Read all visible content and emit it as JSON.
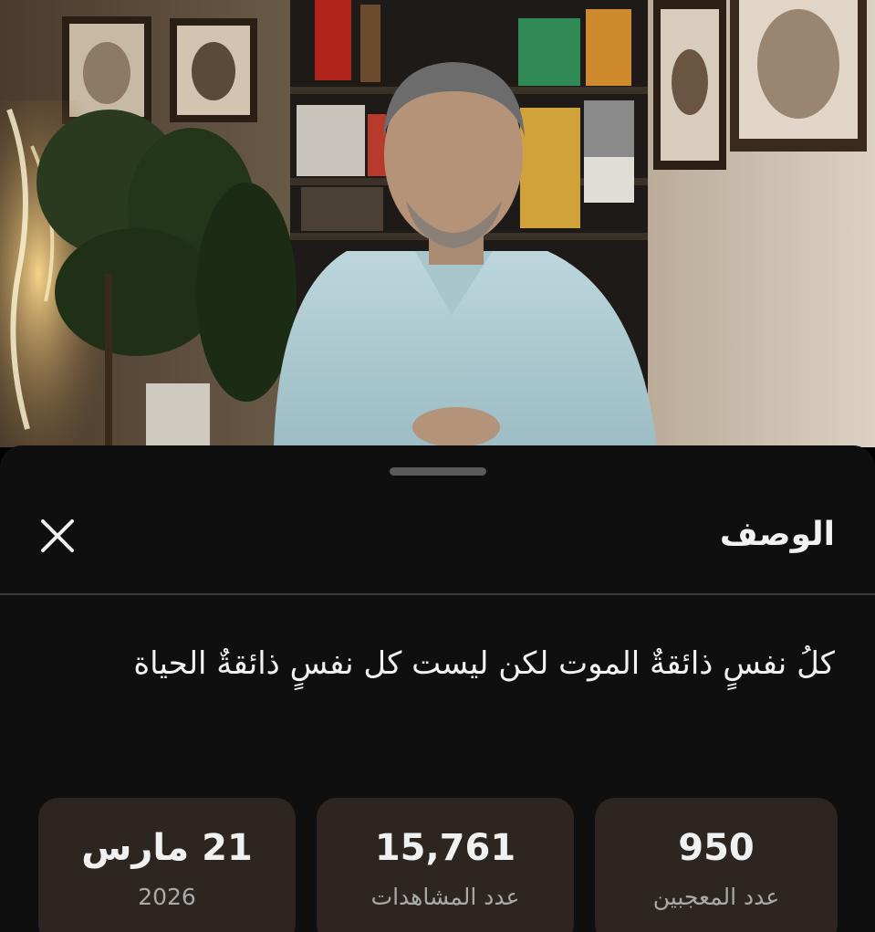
{
  "sheet": {
    "title": "الوصف",
    "description": "كلُ نفسٍ ذائقةٌ الموت لكن ليست كل نفسٍ ذائقةٌ الحياة"
  },
  "stats": [
    {
      "value": "950",
      "label": "عدد المعجبين"
    },
    {
      "value": "15,761",
      "label": "عدد المشاهدات"
    },
    {
      "value": "21 مارس",
      "label": "2026"
    }
  ],
  "icons": {
    "close": "close-icon",
    "drag_handle": "drag-handle"
  },
  "colors": {
    "sheet_background": "#0f0f0f",
    "card_background": "#2c2520",
    "text_primary": "#f1f1f1",
    "text_secondary": "#aaaaaa"
  }
}
